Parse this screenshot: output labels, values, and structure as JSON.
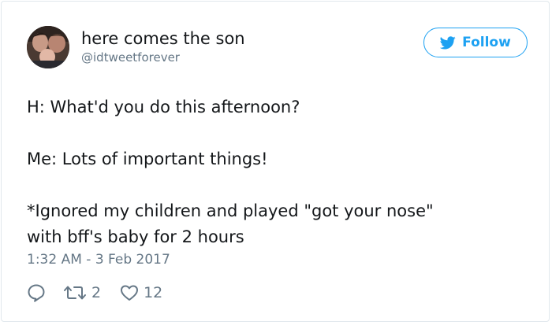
{
  "user": {
    "display_name": "here comes the son",
    "handle": "@idtweetforever"
  },
  "follow_button": {
    "label": "Follow"
  },
  "tweet": {
    "text": "H: What'd you do this afternoon?\n\nMe: Lots of important things!\n\n*Ignored my children and played \"got your nose\"\nwith bff's baby for 2 hours",
    "timestamp": "1:32 AM - 3 Feb 2017"
  },
  "actions": {
    "retweet_count": "2",
    "like_count": "12"
  },
  "icons": {
    "reply": "reply-icon",
    "retweet": "retweet-icon",
    "like": "heart-icon",
    "brand": "twitter-bird-icon"
  },
  "colors": {
    "accent": "#1da1f2",
    "muted": "#657786",
    "text": "#14171a",
    "border": "#e1e8ed"
  }
}
